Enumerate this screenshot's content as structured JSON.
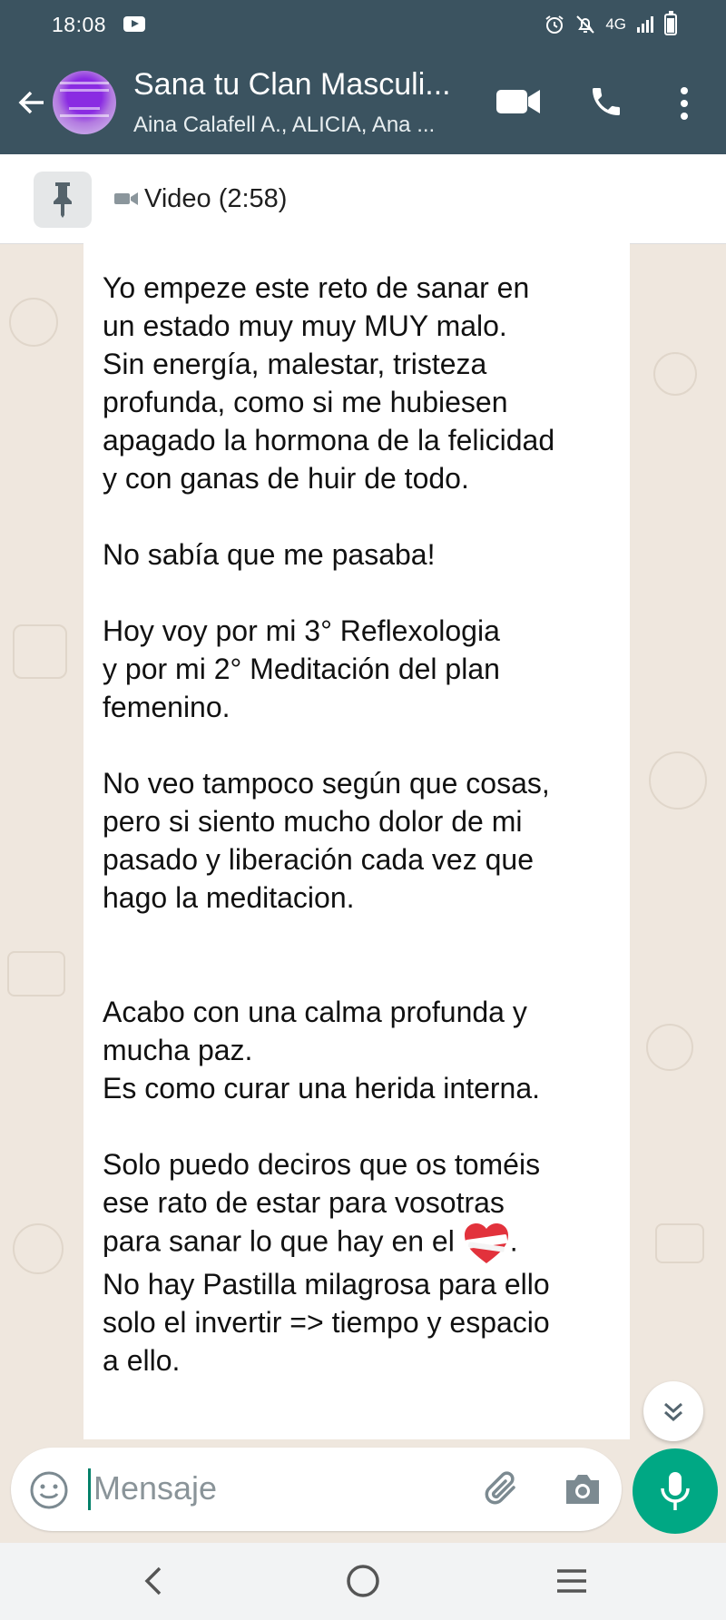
{
  "status_bar": {
    "time": "18:08",
    "network": "4G",
    "icons": [
      "youtube-notification-icon",
      "alarm-icon",
      "mute-icon",
      "signal-icon",
      "battery-icon"
    ],
    "battery_level": 0.8
  },
  "header": {
    "title": "Sana tu Clan Masculi...",
    "subtitle": "Aina Calafell A., ALICIA, Ana ...",
    "icons": [
      "back-arrow-icon",
      "group-avatar",
      "video-call-icon",
      "phone-call-icon",
      "more-options-icon"
    ]
  },
  "pinned": {
    "label": "Video (2:58)",
    "icons": [
      "pin-icon",
      "video-camera-icon"
    ]
  },
  "message": {
    "paragraph_1": "Yo empeze este reto de sanar en\nun estado muy muy MUY malo.\nSin energía, malestar, tristeza\nprofunda, como si me hubiesen\napagado la hormona de la felicidad\ny con ganas de huir de todo.\n\nNo sabía que me pasaba!\n\nHoy voy por mi 3° Reflexologia\ny por mi 2° Meditación del plan\nfemenino.\n\nNo veo tampoco según que cosas,\npero si siento mucho dolor de mi\npasado y liberación cada vez que\nhago la meditacion.\n\n\nAcabo con una calma profunda y\nmucha paz.\nEs como curar una herida interna.\n\nSolo puedo deciros que os toméis\nese rato de estar para vosotras\npara sanar lo que hay en el ",
    "emoji": "bandaged-heart-emoji",
    "paragraph_2": ".\nNo hay Pastilla milagrosa para ello\nsolo el invertir => tiempo y espacio\na ello."
  },
  "composer": {
    "placeholder": "Mensaje",
    "icons": [
      "emoji-icon",
      "attach-icon",
      "camera-icon",
      "mic-icon"
    ]
  },
  "nav_bar": {
    "icons": [
      "nav-back-icon",
      "nav-home-icon",
      "nav-recents-icon"
    ]
  },
  "colors": {
    "header": "#3b5360",
    "accent": "#00a884",
    "chat_background": "#efe7de"
  }
}
